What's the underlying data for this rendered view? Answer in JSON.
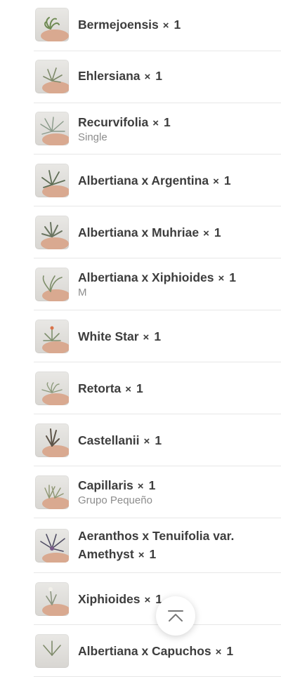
{
  "cart": {
    "quantity_sign": "×",
    "items": [
      {
        "name": "Bermejoensis",
        "qty": "1",
        "variant": ""
      },
      {
        "name": "Ehlersiana",
        "qty": "1",
        "variant": ""
      },
      {
        "name": "Recurvifolia",
        "qty": "1",
        "variant": "Single"
      },
      {
        "name": "Albertiana x Argentina",
        "qty": "1",
        "variant": ""
      },
      {
        "name": "Albertiana x Muhriae",
        "qty": "1",
        "variant": ""
      },
      {
        "name": "Albertiana x Xiphioides",
        "qty": "1",
        "variant": "M"
      },
      {
        "name": "White Star",
        "qty": "1",
        "variant": ""
      },
      {
        "name": "Retorta",
        "qty": "1",
        "variant": ""
      },
      {
        "name": "Castellanii",
        "qty": "1",
        "variant": ""
      },
      {
        "name": "Capillaris",
        "qty": "1",
        "variant": "Grupo Pequeño"
      },
      {
        "name": "Aeranthos x Tenuifolia var. Amethyst",
        "qty": "1",
        "variant": ""
      },
      {
        "name": "Xiphioides",
        "qty": "1",
        "variant": ""
      },
      {
        "name": "Albertiana x Capuchos",
        "qty": "1",
        "variant": ""
      }
    ]
  },
  "scroll_top": {
    "icon": "chevron-up-bar-icon"
  }
}
